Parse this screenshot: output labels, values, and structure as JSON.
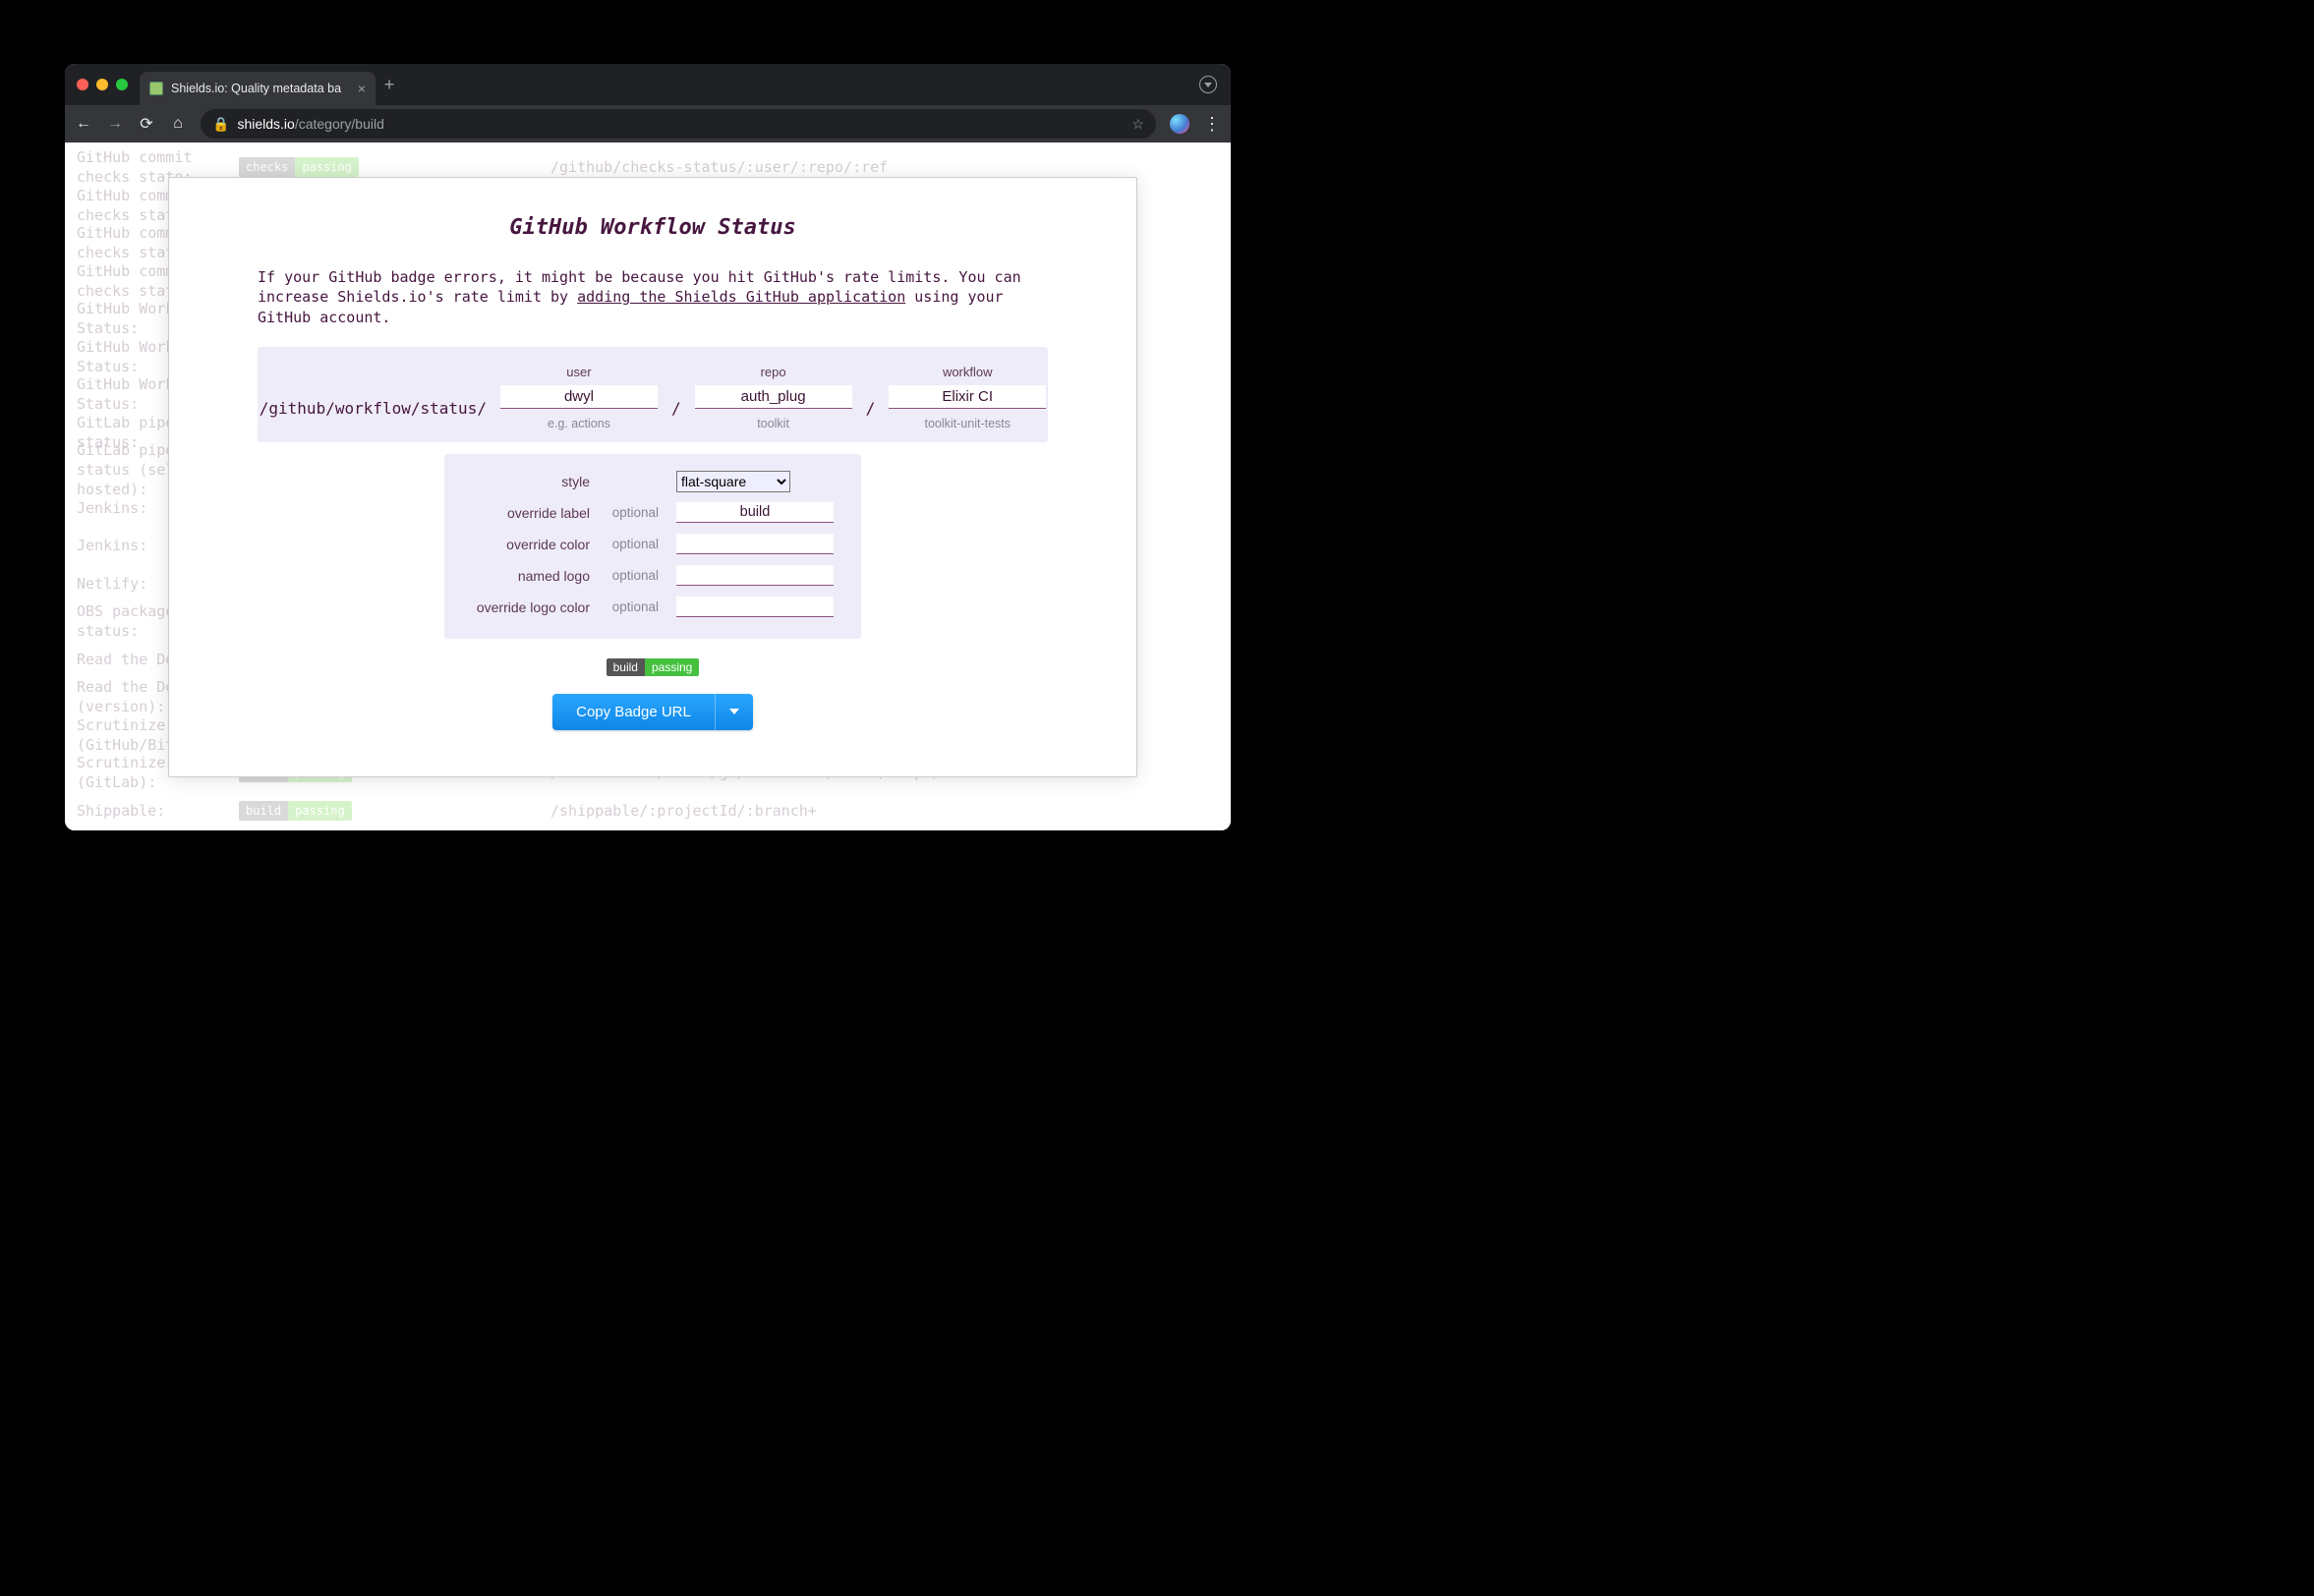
{
  "browser": {
    "tab_title": "Shields.io: Quality metadata ba",
    "url_host": "shields.io",
    "url_path": "/category/build"
  },
  "bg_rows": [
    {
      "name": "GitHub commit checks state:",
      "badge_l": "checks",
      "badge_r": "passing",
      "path": "/github/checks-status/:user/:repo/:ref"
    },
    {
      "name": "GitHub commit checks state:"
    },
    {
      "name": "GitHub commit checks state:"
    },
    {
      "name": "GitHub commit checks state:"
    },
    {
      "name": "GitHub Workflow Status:"
    },
    {
      "name": "GitHub Workflow Status:"
    },
    {
      "name": "GitHub Workflow Status:"
    },
    {
      "name": "GitLab pipeline status:"
    },
    {
      "name": "GitLab pipeline status (self-hosted):"
    },
    {
      "name": "Jenkins:"
    },
    {
      "name": "Jenkins:"
    },
    {
      "name": "Netlify:"
    },
    {
      "name": "OBS package build status:"
    },
    {
      "name": "Read the Docs:"
    },
    {
      "name": "Read the Docs (version):"
    },
    {
      "name": "Scrutinizer build (GitHub/Bitbucket):"
    },
    {
      "name": "Scrutinizer build (GitLab):",
      "badge_l": "build",
      "badge_r": "passing",
      "path": "/scrutinizer/build/gl/:instance/:user/:repo/:branch*"
    },
    {
      "name": "Shippable:",
      "badge_l": "build",
      "badge_r": "passing",
      "path": "/shippable/:projectId/:branch+"
    }
  ],
  "modal": {
    "title": "GitHub Workflow Status",
    "note_pre": "If your GitHub badge errors, it might be because you hit GitHub's rate limits. You can increase Shields.io's rate limit by ",
    "note_link": "adding the Shields GitHub application",
    "note_post": " using your GitHub account.",
    "route": "/github/workflow/status/",
    "params": [
      {
        "label": "user",
        "value": "dwyl",
        "eg": "e.g. actions"
      },
      {
        "label": "repo",
        "value": "auth_plug",
        "eg": "toolkit"
      },
      {
        "label": "workflow",
        "value": "Elixir CI",
        "eg": "toolkit-unit-tests"
      }
    ],
    "options": {
      "style": {
        "label": "style",
        "value": "flat-square"
      },
      "override_label": {
        "label": "override label",
        "hint": "optional",
        "value": "build"
      },
      "override_color": {
        "label": "override color",
        "hint": "optional",
        "value": ""
      },
      "named_logo": {
        "label": "named logo",
        "hint": "optional",
        "value": ""
      },
      "override_logo_color": {
        "label": "override logo color",
        "hint": "optional",
        "value": ""
      }
    },
    "preview": {
      "left": "build",
      "right": "passing"
    },
    "copy_label": "Copy Badge URL"
  }
}
